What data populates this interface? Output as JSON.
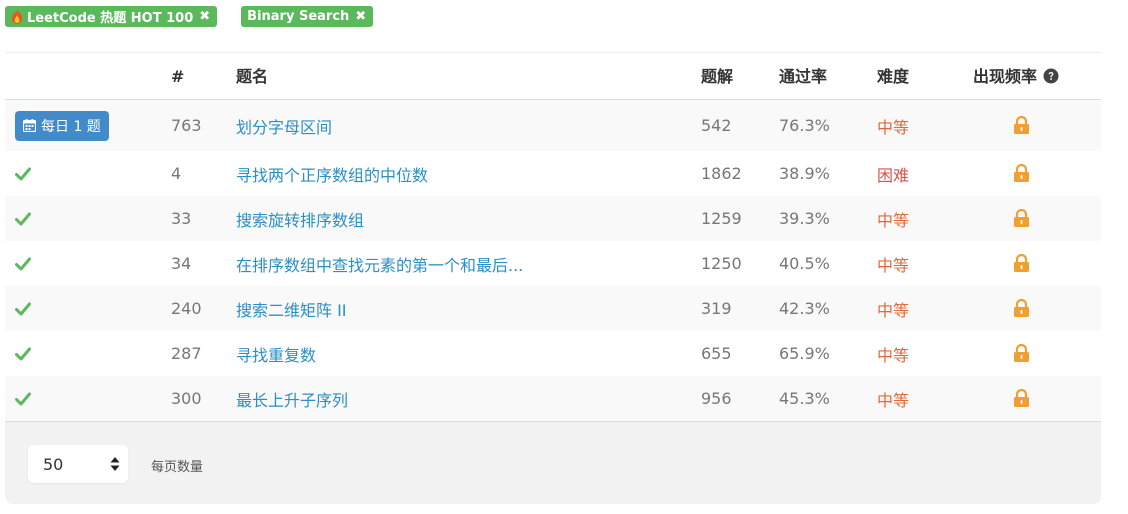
{
  "tags": [
    {
      "label": "LeetCode 热题 HOT 100",
      "icon": "fire-icon",
      "close": "✖"
    },
    {
      "label": "Binary Search",
      "close": "✖"
    }
  ],
  "table": {
    "headers": {
      "status": "",
      "id": "#",
      "title": "题名",
      "solutions": "题解",
      "acceptance": "通过率",
      "difficulty": "难度",
      "frequency": "出现频率"
    },
    "daily_label": "每日 1 题",
    "rows": [
      {
        "status": "daily",
        "id": "763",
        "title": "划分字母区间",
        "solutions": "542",
        "acceptance": "76.3%",
        "difficulty": "中等"
      },
      {
        "status": "solved",
        "id": "4",
        "title": "寻找两个正序数组的中位数",
        "solutions": "1862",
        "acceptance": "38.9%",
        "difficulty": "困难"
      },
      {
        "status": "solved",
        "id": "33",
        "title": "搜索旋转排序数组",
        "solutions": "1259",
        "acceptance": "39.3%",
        "difficulty": "中等"
      },
      {
        "status": "solved",
        "id": "34",
        "title": "在排序数组中查找元素的第一个和最后...",
        "solutions": "1250",
        "acceptance": "40.5%",
        "difficulty": "中等"
      },
      {
        "status": "solved",
        "id": "240",
        "title": "搜索二维矩阵 II",
        "solutions": "319",
        "acceptance": "42.3%",
        "difficulty": "中等"
      },
      {
        "status": "solved",
        "id": "287",
        "title": "寻找重复数",
        "solutions": "655",
        "acceptance": "65.9%",
        "difficulty": "中等"
      },
      {
        "status": "solved",
        "id": "300",
        "title": "最长上升子序列",
        "solutions": "956",
        "acceptance": "45.3%",
        "difficulty": "中等"
      }
    ]
  },
  "pagination": {
    "page_size": "50",
    "page_size_label": "每页数量"
  },
  "colors": {
    "tag": "#5cb85c",
    "link": "#2a8fc6",
    "medium": "#e06a3a",
    "hard": "#d9534f",
    "lock": "#f0ad4e",
    "daily": "#428bca"
  }
}
